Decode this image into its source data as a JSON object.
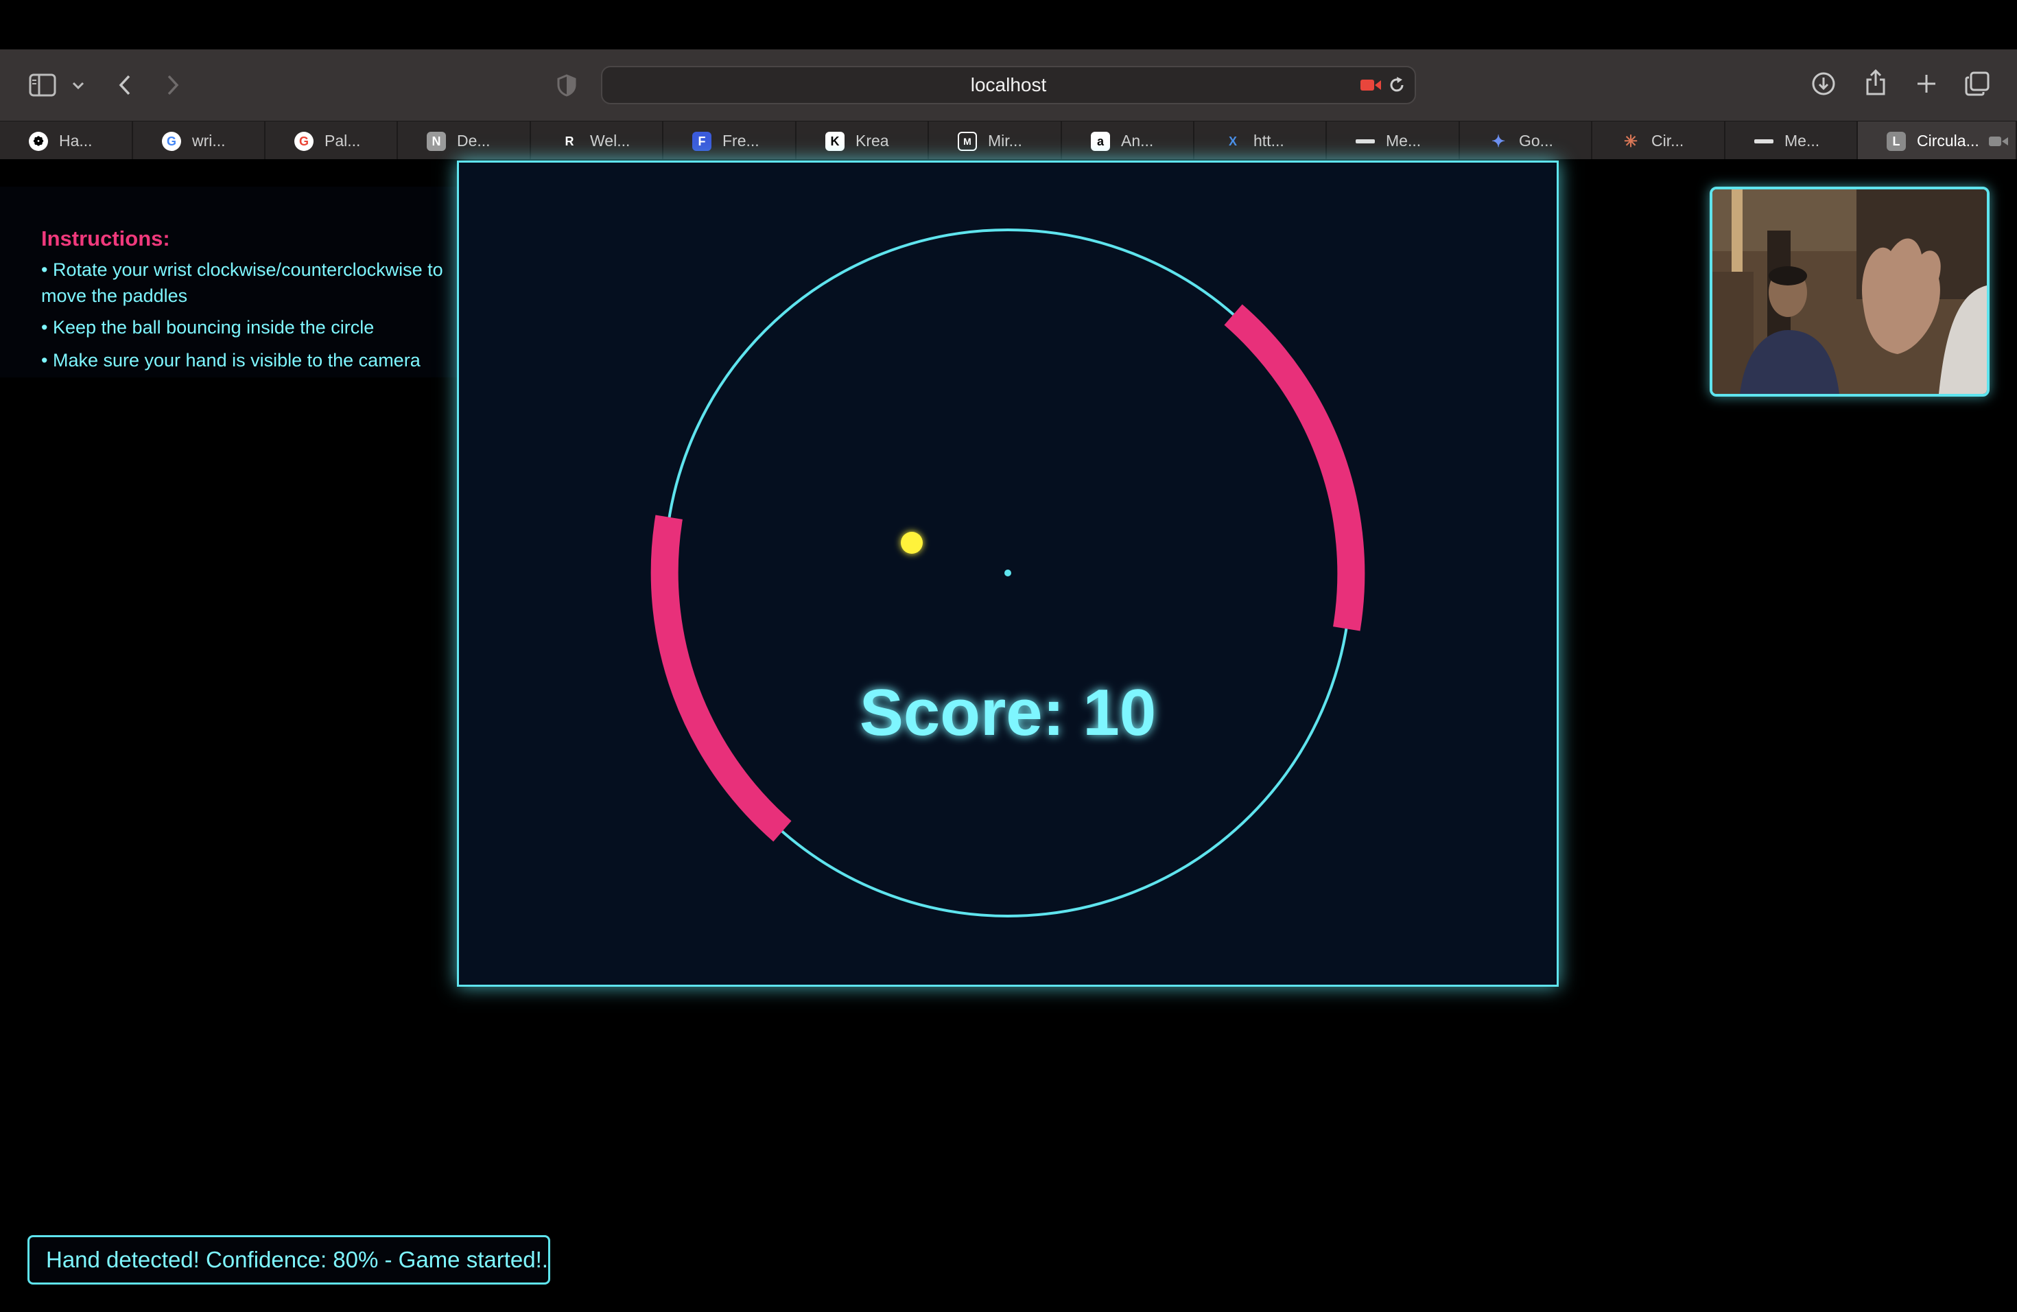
{
  "browser": {
    "url": "localhost",
    "tabs": [
      {
        "label": "Ha...",
        "icon": "openai-icon"
      },
      {
        "label": "wri...",
        "icon": "google-icon"
      },
      {
        "label": "Pal...",
        "icon": "google-icon"
      },
      {
        "label": "De...",
        "icon": "notion-icon"
      },
      {
        "label": "Wel...",
        "icon": "replit-icon"
      },
      {
        "label": "Fre...",
        "icon": "form-icon"
      },
      {
        "label": "Krea",
        "icon": "krea-icon"
      },
      {
        "label": "Mir...",
        "icon": "midjourney-icon"
      },
      {
        "label": "An...",
        "icon": "amazon-icon"
      },
      {
        "label": "htt...",
        "icon": "x-icon"
      },
      {
        "label": "Me...",
        "icon": "meta-icon"
      },
      {
        "label": "Go...",
        "icon": "gemini-icon"
      },
      {
        "label": "Cir...",
        "icon": "claude-icon"
      },
      {
        "label": "Me...",
        "icon": "meta-icon"
      },
      {
        "label": "Circula...",
        "icon": "letter-l-icon",
        "active": true
      }
    ]
  },
  "instructions": {
    "title": "Instructions:",
    "items": [
      "• Rotate your wrist clockwise/counterclockwise to move the paddles",
      "• Keep the ball bouncing inside the circle",
      "• Make sure your hand is visible to the camera"
    ]
  },
  "game": {
    "score_text": "Score: 10",
    "colors": {
      "ring": "#5fe4ee",
      "paddle": "#e8307a",
      "ball": "#fff23a",
      "background": "#050f1f"
    }
  },
  "status": {
    "text": "Hand detected! Confidence: 80% - Game started!."
  }
}
